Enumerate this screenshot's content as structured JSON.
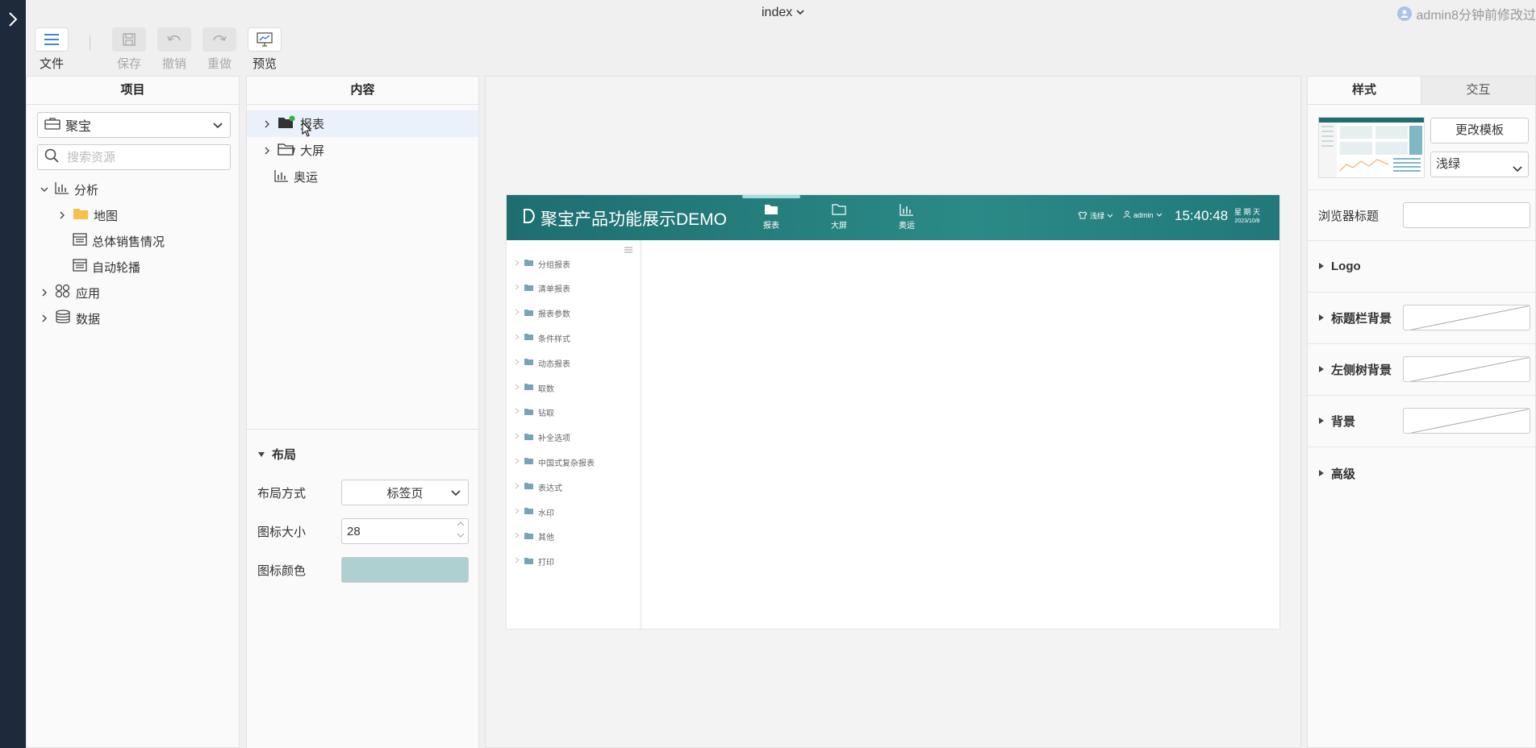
{
  "window": {
    "title": "index",
    "modified_text": "admin8分钟前修改过"
  },
  "toolbar": {
    "file": "文件",
    "save": "保存",
    "undo": "撤销",
    "redo": "重做",
    "preview": "预览"
  },
  "project_panel": {
    "title": "项目",
    "selected_project": "聚宝",
    "search_placeholder": "搜索资源",
    "tree": [
      {
        "label": "分析"
      },
      {
        "label": "地图"
      },
      {
        "label": "总体销售情况"
      },
      {
        "label": "自动轮播"
      },
      {
        "label": "应用"
      },
      {
        "label": "数据"
      }
    ]
  },
  "content_panel": {
    "title": "内容",
    "tree": [
      {
        "label": "报表"
      },
      {
        "label": "大屏"
      },
      {
        "label": "奥运"
      }
    ],
    "layout": {
      "title": "布局",
      "layout_mode_label": "布局方式",
      "layout_mode_value": "标签页",
      "icon_size_label": "图标大小",
      "icon_size_value": "28",
      "icon_color_label": "图标颜色",
      "icon_color": "#afd0d0"
    }
  },
  "preview": {
    "title": "聚宝产品功能展示DEMO",
    "tabs": [
      "报表",
      "大屏",
      "奥运"
    ],
    "theme_label": "浅绿",
    "user_label": "admin",
    "time": "15:40:48",
    "weekday": "星 期 天",
    "date": "2023/10/8",
    "side_items": [
      "分组报表",
      "清单报表",
      "报表参数",
      "条件样式",
      "动态报表",
      "取数",
      "钻取",
      "补全选项",
      "中国式复杂报表",
      "表达式",
      "水印",
      "其他",
      "打印"
    ]
  },
  "props_panel": {
    "tabs": [
      "样式",
      "交互"
    ],
    "change_template": "更改模板",
    "theme": "浅绿",
    "browser_title_label": "浏览器标题",
    "browser_title_value": "",
    "sections": [
      "Logo",
      "标题栏背景",
      "左侧树背景",
      "背景",
      "高级"
    ]
  },
  "colors": {
    "accent": "#1e6e70",
    "strip": "#1e2a3b",
    "selected_row": "#eaf1fb"
  }
}
